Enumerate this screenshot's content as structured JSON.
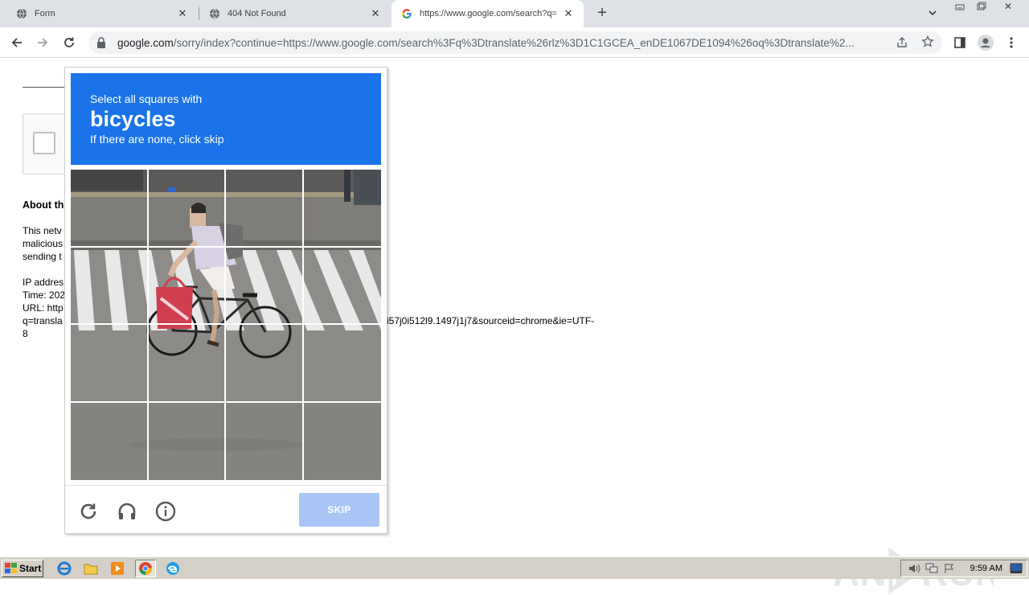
{
  "tabs": [
    {
      "title": "Form",
      "icon": "globe-icon"
    },
    {
      "title": "404 Not Found",
      "icon": "globe-icon"
    },
    {
      "title": "https://www.google.com/search?q=",
      "icon": "google-icon"
    }
  ],
  "toolbar": {
    "url_host": "google.com",
    "url_rest": "/sorry/index?continue=https://www.google.com/search%3Fq%3Dtranslate%26rlz%3D1C1GCEA_enDE1067DE1094%26oq%3Dtranslate%2..."
  },
  "page": {
    "about_heading": "About th",
    "body_lines": [
      "This netv",
      "malicious",
      "sending t"
    ],
    "ip_line": "IP addres",
    "time_line": "Time: 202",
    "url_line": "URL: http",
    "query_line": "q=transla",
    "url_tail": "i57j0i512l9.1497j1j7&sourceid=chrome&ie=UTF-",
    "url_tail2": "8"
  },
  "challenge": {
    "instruction": "Select all squares with",
    "target": "bicycles",
    "hint": "If there are none, click skip",
    "skip_label": "SKIP",
    "grid_rows": 4,
    "grid_cols": 4
  },
  "watermark": "ANY RUN",
  "taskbar": {
    "start_label": "Start",
    "clock": "9:59 AM"
  },
  "colors": {
    "header_blue": "#1a73e8",
    "skip_disabled": "#a8c6f5"
  }
}
